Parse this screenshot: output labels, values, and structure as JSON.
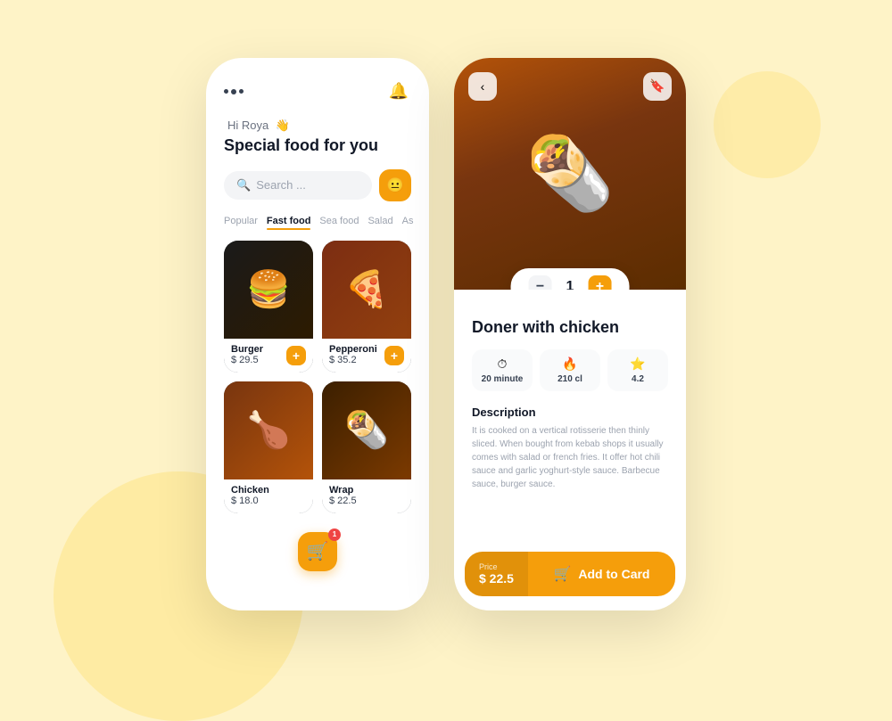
{
  "background": "#fef3c7",
  "left_phone": {
    "greeting": "Hi Roya",
    "greeting_emoji": "👋",
    "title": "Special food for you",
    "search_placeholder": "Search ...",
    "categories": [
      {
        "label": "Popular",
        "active": false
      },
      {
        "label": "Fast food",
        "active": true
      },
      {
        "label": "Sea food",
        "active": false
      },
      {
        "label": "Salad",
        "active": false
      },
      {
        "label": "As",
        "active": false
      }
    ],
    "food_items": [
      {
        "name": "Burger",
        "price": "$ 29.5",
        "emoji": "🍔"
      },
      {
        "name": "Pepperoni",
        "price": "$ 35.2",
        "emoji": "🍕"
      },
      {
        "name": "Chicken",
        "price": "$ 18.0",
        "emoji": "🍗"
      },
      {
        "name": "Wrap",
        "price": "$ 22.5",
        "emoji": "🌯"
      }
    ],
    "cart_count": "1"
  },
  "right_phone": {
    "food_name": "Doner with chicken",
    "quantity": "1",
    "stats": [
      {
        "icon": "⏱",
        "value": "20 minute"
      },
      {
        "icon": "🔥",
        "value": "210 cl"
      },
      {
        "icon": "⭐",
        "value": "4.2"
      }
    ],
    "description_title": "Description",
    "description_text": "It is cooked on a vertical rotisserie then thinly sliced. When bought from kebab shops it usually comes with salad or french fries. It offer hot chili sauce and garlic yoghurt-style sauce. Barbecue sauce, burger sauce.",
    "price_label": "Price",
    "price_value": "$ 22.5",
    "add_to_cart_label": "Add to Card",
    "back_icon": "‹",
    "save_icon": "🔖",
    "minus_label": "−",
    "plus_label": "+"
  }
}
